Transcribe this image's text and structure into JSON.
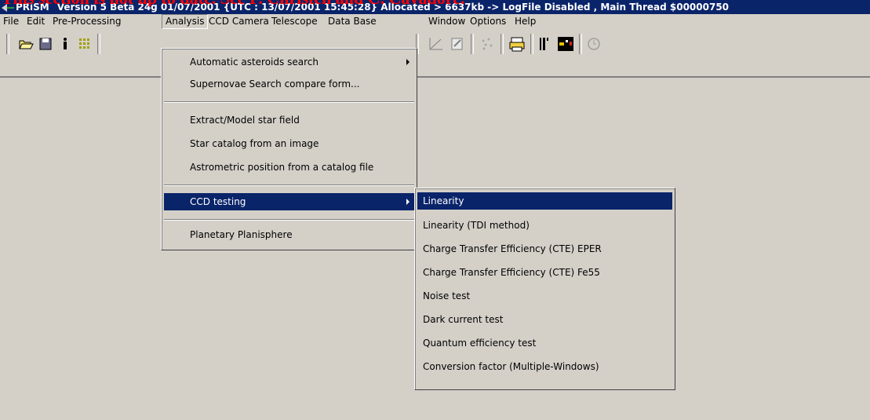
{
  "banner": "This section is not up to date. See F. Christen and C. Cavadore.",
  "titlebar": {
    "app_name": "PRiSM",
    "details": "Version 5 Beta 24g  01/07/2001  {UTC : 13/07/2001 15:45:28} Allocated > 6637kb -> LogFile Disabled , Main Thread $00000750"
  },
  "menubar": [
    "File",
    "Edit",
    "Pre-Processing",
    "Analysis",
    "CCD Camera",
    "Telescope",
    "Data Base",
    "Window",
    "Options",
    "Help"
  ],
  "active_menu": "Analysis",
  "analysis_menu": {
    "items": [
      "Automatic asteroids search",
      "Supernovae Search compare form...",
      "Extract/Model star field",
      "Star catalog from an image",
      "Astrometric position from a catalog file",
      "CCD testing",
      "Planetary Planisphere"
    ]
  },
  "ccd_testing_submenu": {
    "items": [
      "Linearity",
      "Linearity (TDI method)",
      "Charge Transfer Efficiency (CTE) EPER",
      "Charge Transfer Efficiency (CTE) Fe55",
      "Noise test",
      "Dark current test",
      "Quantum efficiency test",
      "Conversion factor (Multiple-Windows)"
    ]
  },
  "toolbar_icons": [
    "open-folder-icon",
    "save-icon",
    "info-icon",
    "grid-icon",
    "chart-icon",
    "edit-icon",
    "stars-icon",
    "printer-icon",
    "barcode-icon",
    "camera-icon",
    "clock-icon"
  ],
  "colors": {
    "titlebar": "#0a246a",
    "banner": "#ff0000",
    "face": "#d4d0c8"
  }
}
